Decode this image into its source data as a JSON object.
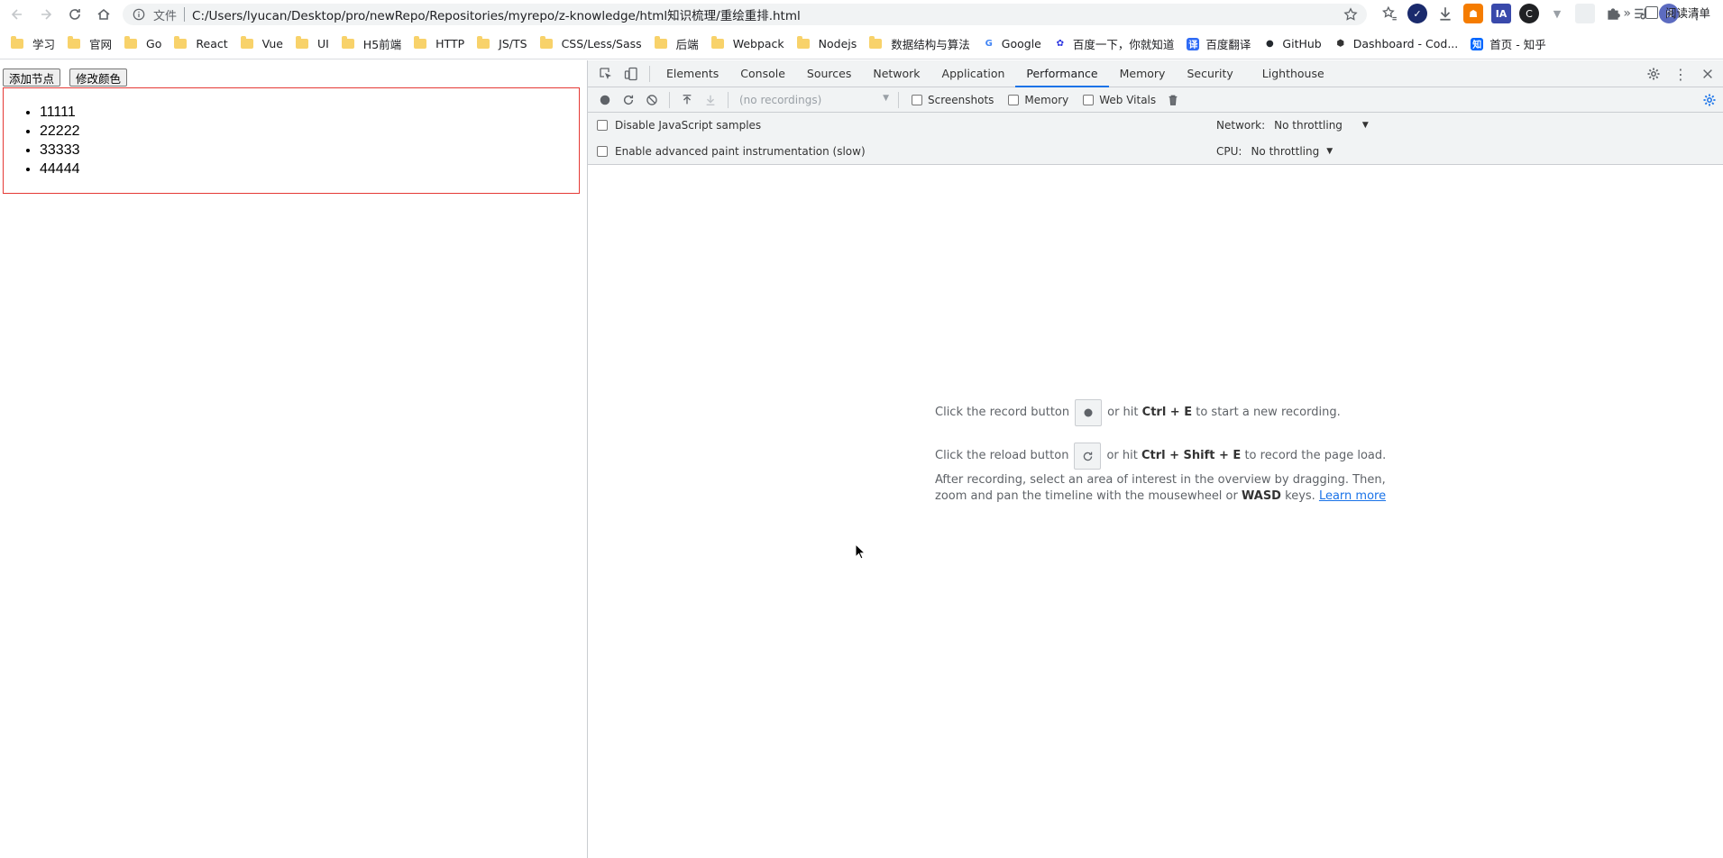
{
  "browser": {
    "scheme_label": "文件",
    "url": "C:/Users/lyucan/Desktop/pro/newRepo/Repositories/myrepo/z-knowledge/html知识梳理/重绘重排.html",
    "profile_initial": "d"
  },
  "bookmarks": [
    {
      "label": "学习",
      "type": "folder"
    },
    {
      "label": "官网",
      "type": "folder"
    },
    {
      "label": "Go",
      "type": "folder"
    },
    {
      "label": "React",
      "type": "folder"
    },
    {
      "label": "Vue",
      "type": "folder"
    },
    {
      "label": "UI",
      "type": "folder"
    },
    {
      "label": "H5前端",
      "type": "folder"
    },
    {
      "label": "HTTP",
      "type": "folder"
    },
    {
      "label": "JS/TS",
      "type": "folder"
    },
    {
      "label": "CSS/Less/Sass",
      "type": "folder"
    },
    {
      "label": "后端",
      "type": "folder"
    },
    {
      "label": "Webpack",
      "type": "folder"
    },
    {
      "label": "Nodejs",
      "type": "folder"
    },
    {
      "label": "数据结构与算法",
      "type": "folder"
    },
    {
      "label": "Google",
      "type": "google"
    },
    {
      "label": "百度一下，你就知道",
      "type": "baidu"
    },
    {
      "label": "百度翻译",
      "type": "fanyi"
    },
    {
      "label": "GitHub",
      "type": "github"
    },
    {
      "label": "Dashboard - Cod...",
      "type": "codepen"
    },
    {
      "label": "首页 - 知乎",
      "type": "zhihu"
    }
  ],
  "bookmarks_more": "»",
  "reading_list": "阅读清单",
  "page": {
    "add_node_button": "添加节点",
    "change_color_button": "修改颜色",
    "list_items": [
      "11111",
      "22222",
      "33333",
      "44444"
    ],
    "box_border_color": "#e53935"
  },
  "devtools": {
    "tabs": [
      "Elements",
      "Console",
      "Sources",
      "Network",
      "Application",
      "Performance",
      "Memory",
      "Security",
      "Lighthouse"
    ],
    "active_tab": "Performance",
    "recordings_placeholder": "(no recordings)",
    "checks": {
      "screenshots": "Screenshots",
      "memory": "Memory",
      "web_vitals": "Web Vitals"
    },
    "settings": {
      "disable_js_samples": "Disable JavaScript samples",
      "advanced_paint": "Enable advanced paint instrumentation (slow)",
      "network_label": "Network:",
      "network_value": "No throttling",
      "cpu_label": "CPU:",
      "cpu_value": "No throttling"
    },
    "landing": {
      "record_pre": "Click the record button",
      "record_mid": "or hit",
      "record_keys": "Ctrl + E",
      "record_post": "to start a new recording.",
      "reload_pre": "Click the reload button",
      "reload_mid": "or hit",
      "reload_keys": "Ctrl + Shift + E",
      "reload_post": "to record the page load.",
      "after_text_1": "After recording, select an area of interest in the overview by dragging. Then, zoom and pan the timeline with the mousewheel or",
      "after_keys": "WASD",
      "after_text_2": "keys.",
      "learn_more": "Learn more"
    },
    "accent_color": "#1a73e8"
  }
}
